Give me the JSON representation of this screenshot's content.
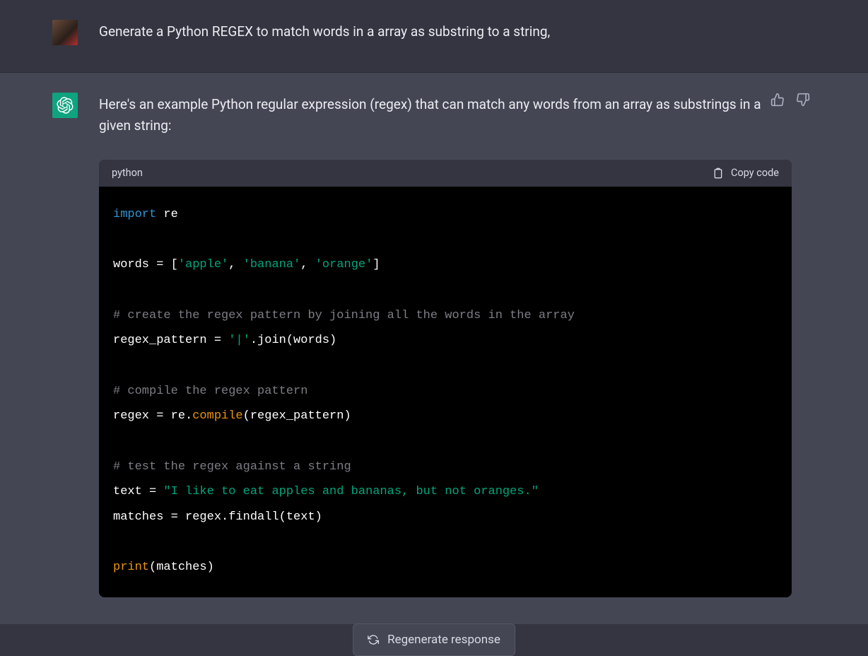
{
  "user_message": "Generate a Python REGEX to match words in a array as substring to a string,",
  "assistant_intro": "Here's an example Python regular expression (regex) that can match any words from an array as substrings in a given string:",
  "code_lang": "python",
  "copy_label": "Copy code",
  "regenerate_label": "Regenerate response",
  "code": {
    "line1_import": "import",
    "line1_mod": " re",
    "line3_words": "words = [",
    "line3_s1": "'apple'",
    "line3_c1": ", ",
    "line3_s2": "'banana'",
    "line3_c2": ", ",
    "line3_s3": "'orange'",
    "line3_close": "]",
    "line5_cmt": "# create the regex pattern by joining all the words in the array",
    "line6_a": "regex_pattern = ",
    "line6_str": "'|'",
    "line6_b": ".join(words)",
    "line8_cmt": "# compile the regex pattern",
    "line9_a": "regex = re.",
    "line9_fn": "compile",
    "line9_b": "(regex_pattern)",
    "line11_cmt": "# test the regex against a string",
    "line12_a": "text = ",
    "line12_str": "\"I like to eat apples and bananas, but not oranges.\"",
    "line13": "matches = regex.findall(text)",
    "line15_fn": "print",
    "line15_b": "(matches)"
  }
}
